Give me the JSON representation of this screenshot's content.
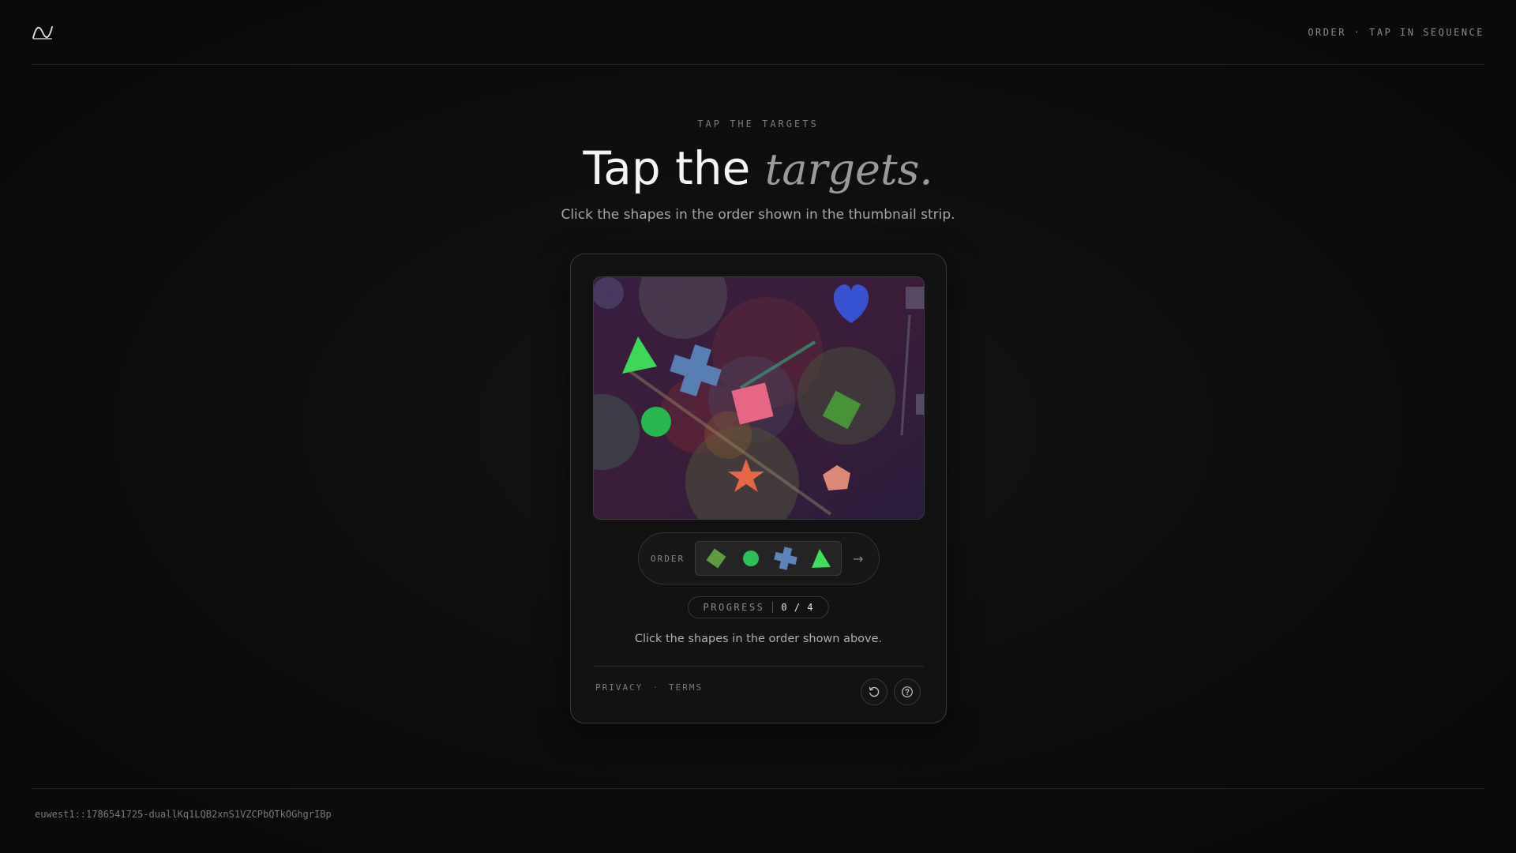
{
  "topbar": {
    "logo": "wave-logo-icon",
    "mode_label": "ORDER · TAP IN SEQUENCE"
  },
  "header": {
    "eyebrow": "TAP THE TARGETS",
    "title_main": "Tap the ",
    "title_accent": "targets.",
    "subtitle": "Click the shapes in the order shown in the thumbnail strip."
  },
  "challenge": {
    "canvas_targets": [
      "triangle",
      "cross",
      "circle",
      "square",
      "diamond",
      "heart",
      "star",
      "pentagon"
    ],
    "order_label": "ORDER",
    "order_sequence": [
      "diamond",
      "circle",
      "cross",
      "triangle"
    ],
    "order_arrow": "→",
    "progress_label": "PROGRESS",
    "progress_value": "0 / 4",
    "progress_done": 0,
    "progress_total": 4,
    "instruction": "Click the shapes in the order shown above."
  },
  "footer": {
    "privacy": "PRIVACY",
    "separator": "·",
    "terms": "TERMS",
    "refresh_icon": "refresh-icon",
    "help_icon": "help-icon"
  },
  "session_id": "euwest1::1786541725-duallKq1LQB2xnS1VZCPbQTkOGhgrIBp",
  "colors": {
    "background": "#0d0d0d",
    "card": "#121212",
    "canvas": "#3a1f45",
    "green": "#3ee05a",
    "blue_cross": "#5b84b8",
    "pink": "#f06a8a",
    "orange": "#f07050"
  }
}
